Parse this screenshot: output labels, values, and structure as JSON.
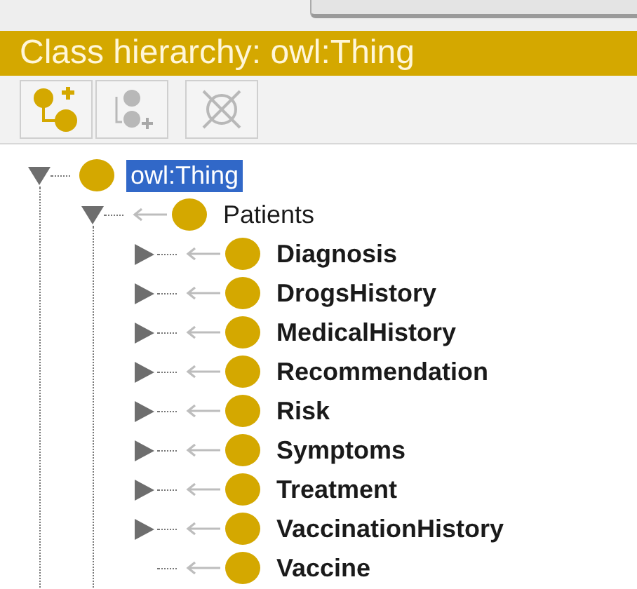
{
  "header": {
    "title": "Class hierarchy: owl:Thing"
  },
  "toolbar": [
    {
      "kind": "add-subclass",
      "disabled": false
    },
    {
      "kind": "add-sibling",
      "disabled": true
    },
    {
      "kind": "delete",
      "disabled": true
    }
  ],
  "tree": [
    {
      "label": "owl:Thing",
      "selected": true,
      "bold": false,
      "kind": "branch",
      "expanded": true,
      "children": [
        {
          "label": "Patients",
          "selected": false,
          "bold": false,
          "kind": "branch",
          "expanded": true,
          "children": [
            {
              "label": "Diagnosis",
              "selected": false,
              "bold": true,
              "kind": "branch",
              "expanded": false
            },
            {
              "label": "DrogsHistory",
              "selected": false,
              "bold": true,
              "kind": "branch",
              "expanded": false
            },
            {
              "label": "MedicalHistory",
              "selected": false,
              "bold": true,
              "kind": "branch",
              "expanded": false
            },
            {
              "label": "Recommendation",
              "selected": false,
              "bold": true,
              "kind": "branch",
              "expanded": false
            },
            {
              "label": "Risk",
              "selected": false,
              "bold": true,
              "kind": "branch",
              "expanded": false
            },
            {
              "label": "Symptoms",
              "selected": false,
              "bold": true,
              "kind": "branch",
              "expanded": false
            },
            {
              "label": "Treatment",
              "selected": false,
              "bold": true,
              "kind": "branch",
              "expanded": false
            },
            {
              "label": "VaccinationHistory",
              "selected": false,
              "bold": true,
              "kind": "branch",
              "expanded": false
            },
            {
              "label": "Vaccine",
              "selected": false,
              "bold": true,
              "kind": "leaf"
            }
          ]
        }
      ]
    }
  ]
}
